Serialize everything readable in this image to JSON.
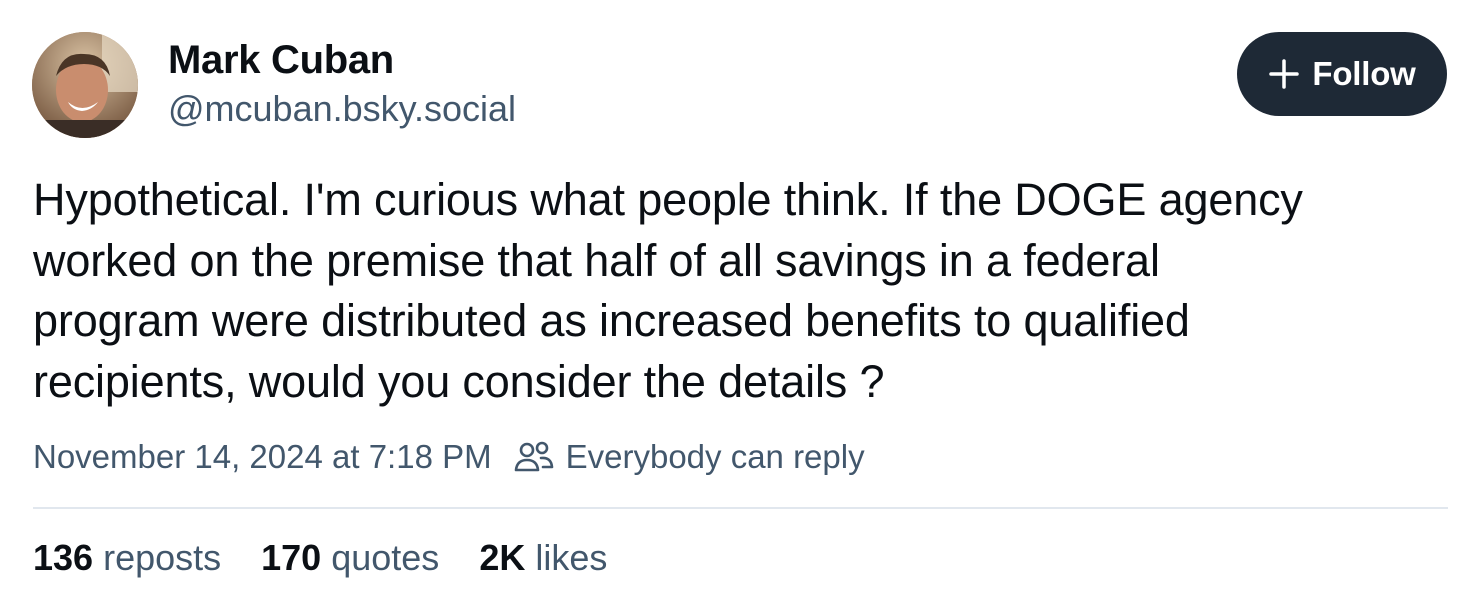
{
  "author": {
    "name": "Mark Cuban",
    "handle": "@mcuban.bsky.social"
  },
  "follow": {
    "label": "Follow",
    "icon": "plus-icon"
  },
  "post": {
    "lines": [
      "Hypothetical. I'm curious what people think. If the DOGE agency",
      "worked on the premise that half of all savings in a federal",
      "program were distributed as increased benefits to qualified",
      "recipients, would you consider the details ?"
    ],
    "timestamp": "November 14, 2024 at 7:18 PM",
    "reply_setting": "Everybody can reply",
    "reply_icon": "people-icon"
  },
  "stats": {
    "reposts": {
      "count": "136",
      "label": "reposts"
    },
    "quotes": {
      "count": "170",
      "label": "quotes"
    },
    "likes": {
      "count": "2K",
      "label": "likes"
    }
  },
  "colors": {
    "follow_bg": "#1e2936",
    "secondary_text": "#42576c",
    "primary_text": "#0b0f14",
    "divider": "#e1e7ee"
  }
}
